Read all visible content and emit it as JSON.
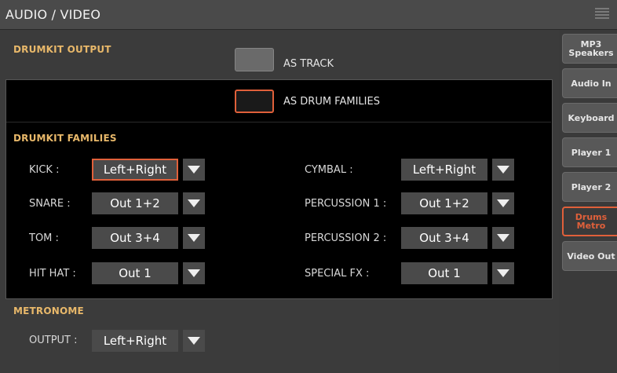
{
  "header": {
    "title": "AUDIO / VIDEO"
  },
  "drumkit_output": {
    "heading": "DRUMKIT OUTPUT",
    "option_track": "AS TRACK",
    "option_families": "AS DRUM FAMILIES"
  },
  "families": {
    "heading": "DRUMKIT FAMILIES",
    "rows_left": [
      {
        "label": "KICK :",
        "value": "Left+Right"
      },
      {
        "label": "SNARE :",
        "value": "Out 1+2"
      },
      {
        "label": "TOM :",
        "value": "Out 3+4"
      },
      {
        "label": "HIT HAT :",
        "value": "Out 1"
      }
    ],
    "rows_right": [
      {
        "label": "CYMBAL :",
        "value": "Left+Right"
      },
      {
        "label": "PERCUSSION 1 :",
        "value": "Out 1+2"
      },
      {
        "label": "PERCUSSION 2 :",
        "value": "Out 3+4"
      },
      {
        "label": "SPECIAL FX :",
        "value": "Out 1"
      }
    ]
  },
  "metronome": {
    "heading": "METRONOME",
    "output_label": "OUTPUT :",
    "output_value": "Left+Right"
  },
  "sidebar": {
    "tabs": [
      {
        "label": "MP3 Speakers"
      },
      {
        "label": "Audio In"
      },
      {
        "label": "Keyboard"
      },
      {
        "label": "Player 1"
      },
      {
        "label": "Player 2"
      },
      {
        "label": "Drums Metro"
      },
      {
        "label": "Video Out"
      }
    ],
    "active_tab": "Drums Metro"
  },
  "colors": {
    "accent": "#e0603a",
    "heading": "#e8b86a"
  },
  "icons": {
    "menu": "menu-icon",
    "dropdown": "chevron-down-icon"
  }
}
